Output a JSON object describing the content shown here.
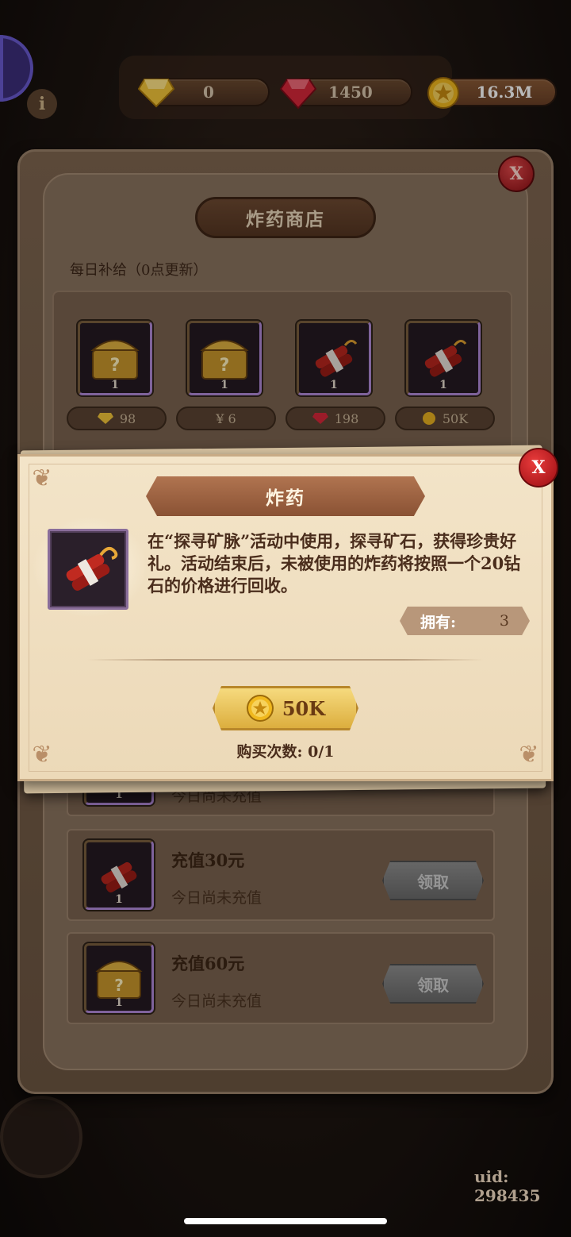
{
  "topbar": {
    "diamond_value": "0",
    "ruby_value": "1450",
    "gold_value": "16.3M"
  },
  "shop": {
    "title": "炸药商店",
    "daily_label": "每日补给（0点更新）",
    "daily_items": [
      {
        "type": "chest",
        "qty": "1",
        "price": "98",
        "price_icon": "diamond-icon"
      },
      {
        "type": "chest",
        "qty": "1",
        "price": "¥ 6",
        "price_icon": ""
      },
      {
        "type": "dynamite",
        "qty": "1",
        "price": "198",
        "price_icon": "ruby-icon"
      },
      {
        "type": "dynamite",
        "qty": "1",
        "price": "50K",
        "price_icon": "coin-icon"
      }
    ],
    "recharge_rows": [
      {
        "qty": "1",
        "title": "",
        "subtitle": "今日尚未充值",
        "button": ""
      },
      {
        "qty": "1",
        "title": "充值30元",
        "subtitle": "今日尚未充值",
        "button": "领取"
      },
      {
        "qty": "1",
        "title": "充值60元",
        "subtitle": "今日尚未充值",
        "button": "领取"
      }
    ],
    "close_label": "X"
  },
  "popup": {
    "title": "炸药",
    "close_label": "X",
    "description": "在“探寻矿脉”活动中使用，探寻矿石，获得珍贵好礼。活动结束后，未被使用的炸药将按照一个20钻石的价格进行回收。",
    "own_label": "拥有:",
    "own_value": "3",
    "buy_price": "50K",
    "buy_count": "购买次数: 0/1"
  },
  "footer": {
    "uid": "uid: 298435"
  },
  "colors": {
    "panel": "#7e6650",
    "popup": "#f3e4c8",
    "gold": "#f6da7e",
    "close_red": "#e0484a"
  }
}
